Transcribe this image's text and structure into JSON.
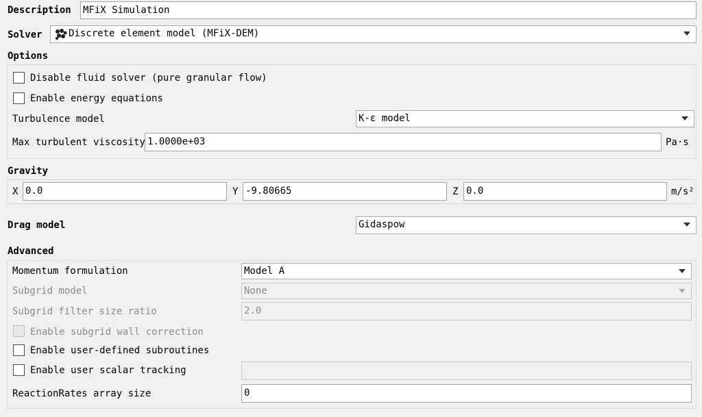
{
  "description": {
    "label": "Description",
    "value": "MFiX Simulation"
  },
  "solver": {
    "label": "Solver",
    "value": "Discrete element model (MFiX-DEM)",
    "icon": "particles-icon"
  },
  "options": {
    "title": "Options",
    "disable_fluid": "Disable fluid solver (pure granular flow)",
    "enable_energy": "Enable energy equations",
    "turbulence_label": "Turbulence model",
    "turbulence_value": "K-ε model",
    "max_visc_label": "Max turbulent viscosity",
    "max_visc_value": "1.0000e+03",
    "max_visc_unit": "Pa·s"
  },
  "gravity": {
    "title": "Gravity",
    "x_label": "X",
    "x_value": "0.0",
    "y_label": "Y",
    "y_value": "-9.80665",
    "z_label": "Z",
    "z_value": "0.0",
    "unit": "m/s²"
  },
  "drag": {
    "label": "Drag model",
    "value": "Gidaspow"
  },
  "advanced": {
    "title": "Advanced",
    "momentum_label": "Momentum formulation",
    "momentum_value": "Model A",
    "subgrid_label": "Subgrid model",
    "subgrid_value": "None",
    "filter_label": "Subgrid filter size ratio",
    "filter_value": "2.0",
    "wall_correction": "Enable subgrid wall correction",
    "user_subroutines": "Enable user-defined subroutines",
    "scalar_tracking": "Enable user scalar tracking",
    "scalar_value": "",
    "reaction_label": "ReactionRates array size",
    "reaction_value": "0"
  }
}
